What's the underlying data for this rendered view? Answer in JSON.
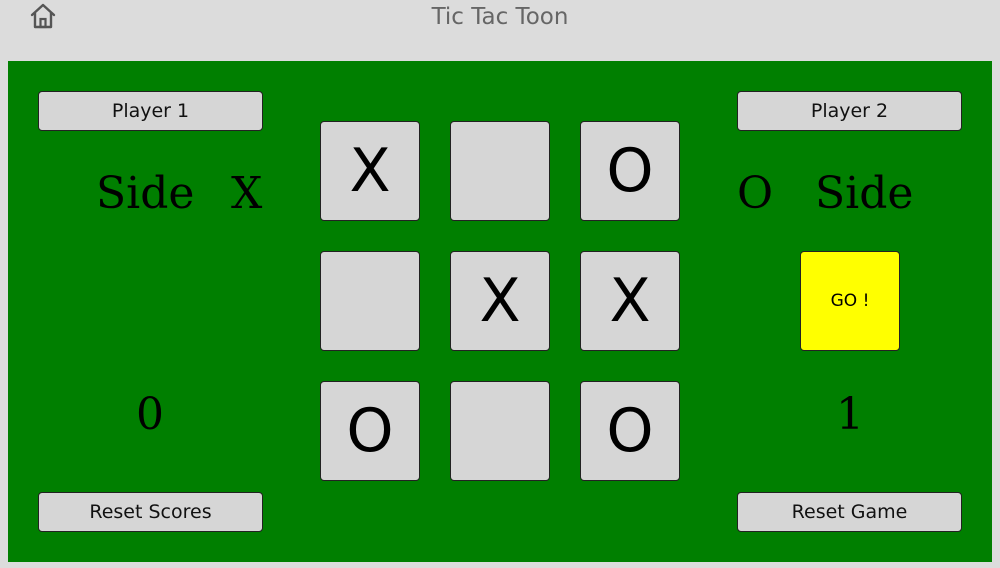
{
  "header": {
    "title": "Tic Tac Toon",
    "home_icon": "home-icon"
  },
  "player1": {
    "button_label": "Player 1",
    "side_label": "Side",
    "side_value": "X",
    "score": "0",
    "reset_label": "Reset Scores"
  },
  "player2": {
    "button_label": "Player 2",
    "side_label": "Side",
    "side_value": "O",
    "score": "1",
    "reset_label": "Reset Game",
    "go_label": "GO !"
  },
  "grid": [
    "X",
    "",
    "O",
    "",
    "X",
    "X",
    "O",
    "",
    "O"
  ],
  "colors": {
    "board": "#007f00",
    "go_button": "#ffff00",
    "cell": "#d6d6d6"
  }
}
